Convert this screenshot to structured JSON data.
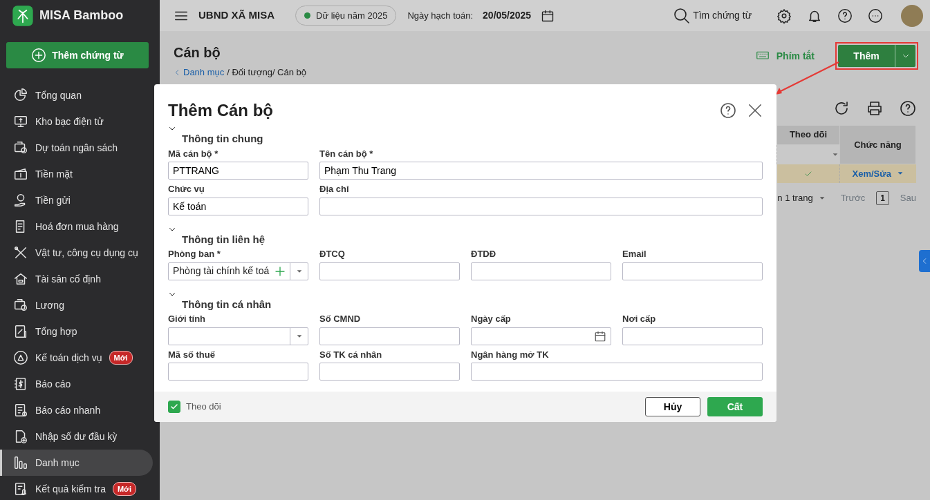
{
  "app": {
    "name": "MISA Bamboo"
  },
  "sidebar": {
    "add_button": "Thêm chứng từ",
    "items": [
      {
        "label": "Tổng quan",
        "selected": false
      },
      {
        "label": "Kho bạc điện tử",
        "selected": false
      },
      {
        "label": "Dự toán ngân sách",
        "selected": false
      },
      {
        "label": "Tiền mặt",
        "selected": false
      },
      {
        "label": "Tiền gửi",
        "selected": false
      },
      {
        "label": "Hoá đơn mua hàng",
        "selected": false
      },
      {
        "label": "Vật tư, công cụ dụng cụ",
        "selected": false
      },
      {
        "label": "Tài sản cố định",
        "selected": false
      },
      {
        "label": "Lương",
        "selected": false
      },
      {
        "label": "Tổng hợp",
        "selected": false
      },
      {
        "label": "Kế toán dịch vụ",
        "selected": false,
        "badge": "Mới"
      },
      {
        "label": "Báo cáo",
        "selected": false
      },
      {
        "label": "Báo cáo nhanh",
        "selected": false
      },
      {
        "label": "Nhập số dư đầu kỳ",
        "selected": false
      },
      {
        "label": "Danh mục",
        "selected": true
      },
      {
        "label": "Kết quả kiểm tra",
        "selected": false,
        "badge": "Mới"
      }
    ]
  },
  "topbar": {
    "org": "UBND XÃ MISA",
    "data_year": "Dữ liệu năm 2025",
    "date_label": "Ngày hạch toán:",
    "date_value": "20/05/2025",
    "search": "Tìm chứng từ"
  },
  "page": {
    "title": "Cán bộ",
    "breadcrumb": {
      "back_link": "Danh mục",
      "rest": "/ Đối tượng/ Cán bộ"
    },
    "shortcut": "Phím tắt",
    "add_button": "Thêm"
  },
  "grid": {
    "columns": [
      "Theo dõi",
      "Chức năng"
    ],
    "rows": [
      {
        "followed": true,
        "action": "Xem/Sửa"
      }
    ],
    "pagination": {
      "summary": "n 1 trang",
      "prev": "Trước",
      "page": "1",
      "next": "Sau"
    }
  },
  "dialog": {
    "title": "Thêm Cán bộ",
    "sections": [
      {
        "title": "Thông tin chung",
        "expanded": true,
        "fields": [
          {
            "label": "Mã cán bộ *",
            "kind": "text",
            "value": "PTTRANG"
          },
          {
            "label": "Tên cán bộ *",
            "kind": "text",
            "value": "Phạm Thu Trang",
            "wide": true
          },
          {
            "label": "Chức vụ",
            "kind": "text",
            "value": "Kế toán"
          },
          {
            "label": "Địa chỉ",
            "kind": "text",
            "wide": true
          }
        ]
      },
      {
        "title": "Thông tin liên hệ",
        "expanded": true,
        "fields": [
          {
            "label": "Phòng ban *",
            "kind": "combo_add",
            "value": "Phòng tài chính kế toá"
          },
          {
            "label": "ĐTCQ",
            "kind": "text"
          },
          {
            "label": "ĐTDĐ",
            "kind": "text"
          },
          {
            "label": "Email",
            "kind": "text"
          }
        ]
      },
      {
        "title": "Thông tin cá nhân",
        "expanded": true,
        "fields": [
          {
            "label": "Giới tính",
            "kind": "combo"
          },
          {
            "label": "Số CMND",
            "kind": "text"
          },
          {
            "label": "Ngày cấp",
            "kind": "date"
          },
          {
            "label": "Nơi cấp",
            "kind": "text"
          },
          {
            "label": "Mã số thuế",
            "kind": "text"
          },
          {
            "label": "Số TK cá nhân",
            "kind": "text"
          },
          {
            "label": "Ngân hàng mở TK",
            "kind": "text",
            "wide": true
          }
        ]
      }
    ],
    "footer": {
      "follow": {
        "label": "Theo dõi",
        "checked": true
      },
      "cancel": "Hủy",
      "save": "Cất"
    }
  }
}
